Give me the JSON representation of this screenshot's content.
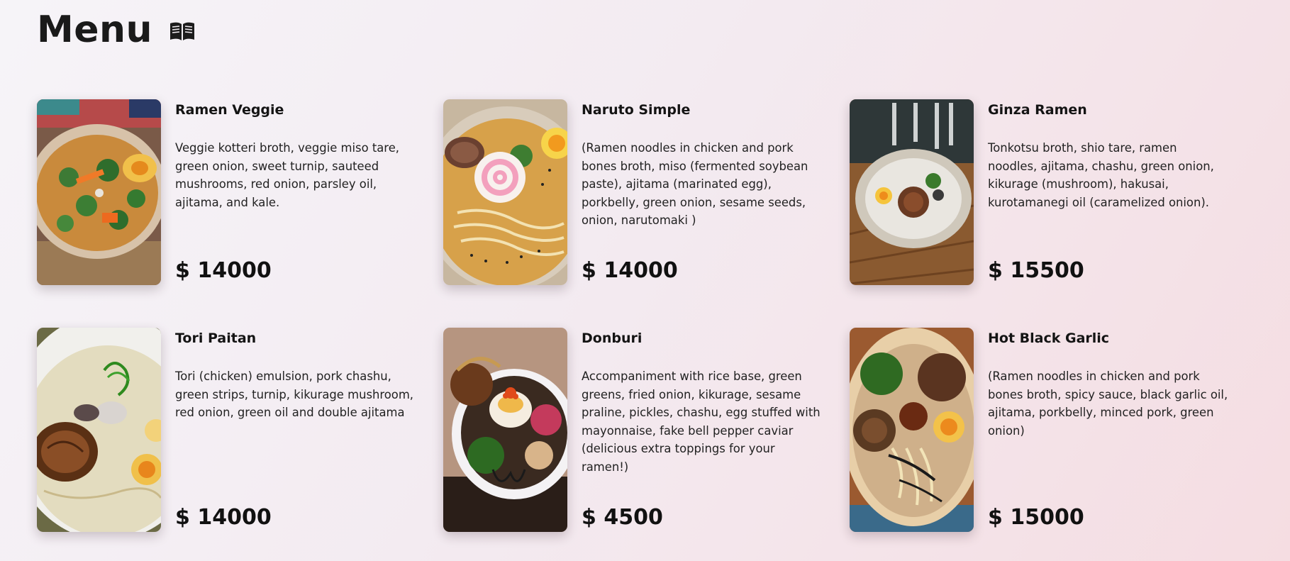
{
  "header": {
    "title": "Menu",
    "icon": "open-book-icon"
  },
  "menu": [
    {
      "name": "Ramen Veggie",
      "description": "Veggie kotteri broth, veggie miso tare, green onion, sweet turnip, sauteed mushrooms, red onion, parsley oil, ajitama, and kale.",
      "price": "$ 14000",
      "image": "ramen-veggie-photo"
    },
    {
      "name": "Naruto Simple",
      "description": "(Ramen noodles in chicken and pork bones broth, miso (fermented soybean paste), ajitama (marinated egg), porkbelly, green onion, sesame seeds, onion, narutomaki )",
      "price": "$ 14000",
      "image": "naruto-simple-photo"
    },
    {
      "name": "Ginza Ramen",
      "description": "Tonkotsu broth, shio tare, ramen noodles, ajitama, chashu, green onion, kikurage (mushroom), hakusai, kurotamanegi oil (caramelized onion).",
      "price": "$ 15500",
      "image": "ginza-ramen-photo"
    },
    {
      "name": "Tori Paitan",
      "description": "Tori (chicken) emulsion, pork chashu, green strips, turnip, kikurage mushroom, red onion, green oil and double ajitama",
      "price": "$ 14000",
      "image": "tori-paitan-photo"
    },
    {
      "name": "Donburi",
      "description": "Accompaniment with rice base, green greens, fried onion, kikurage, sesame praline, pickles, chashu, egg stuffed with mayonnaise, fake bell pepper caviar (delicious extra toppings for your ramen!)",
      "price": "$ 4500",
      "image": "donburi-photo"
    },
    {
      "name": "Hot Black Garlic",
      "description": "(Ramen noodles in chicken and pork bones broth, spicy sauce, black garlic oil, ajitama, porkbelly, minced pork, green onion)",
      "price": "$ 15000",
      "image": "hot-black-garlic-photo"
    }
  ],
  "colors": {
    "text": "#1c1c1c",
    "background_start": "#f6f4f8",
    "background_end": "#f5dde2"
  }
}
